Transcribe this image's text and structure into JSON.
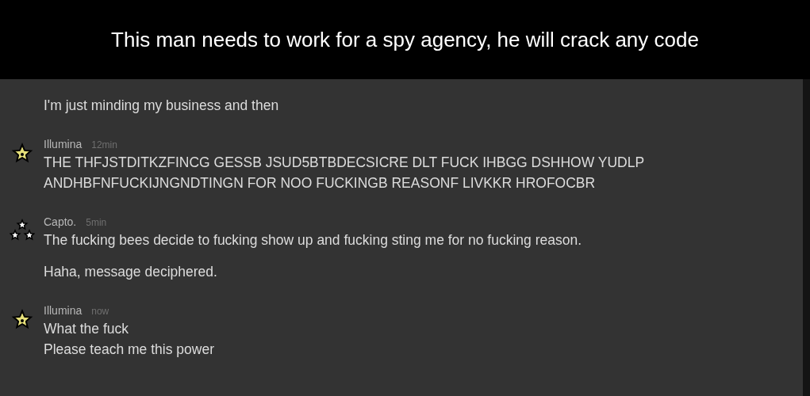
{
  "caption": "This man needs to work for a spy agency, he will crack any code",
  "groups": [
    {
      "messages": [
        {
          "lines": [
            "I'm just minding my business and then"
          ]
        }
      ]
    },
    {
      "author": {
        "name": "Illumina",
        "time": "12min",
        "kind": "star"
      },
      "messages": [
        {
          "lines": [
            "THE THFJSTDITKZFINCG GESSB JSUD5BTBDECSICRE DLT FUCK IHBGG DSHHOW YUDLP",
            "ANDHBFNFUCKIJNGNDTINGN FOR NOO FUCKINGB REASONF LIVKKR HROFOCBR"
          ]
        }
      ]
    },
    {
      "author": {
        "name": "Capto.",
        "time": "5min",
        "kind": "three-stars"
      },
      "messages": [
        {
          "lines": [
            "The fucking bees decide to fucking show up and fucking sting me for no fucking reason."
          ]
        },
        {
          "lines": [
            "Haha, message deciphered."
          ]
        }
      ]
    },
    {
      "author": {
        "name": "Illumina",
        "time": "now",
        "kind": "star"
      },
      "messages": [
        {
          "lines": [
            "What the fuck",
            "Please teach me this power"
          ]
        }
      ]
    }
  ]
}
